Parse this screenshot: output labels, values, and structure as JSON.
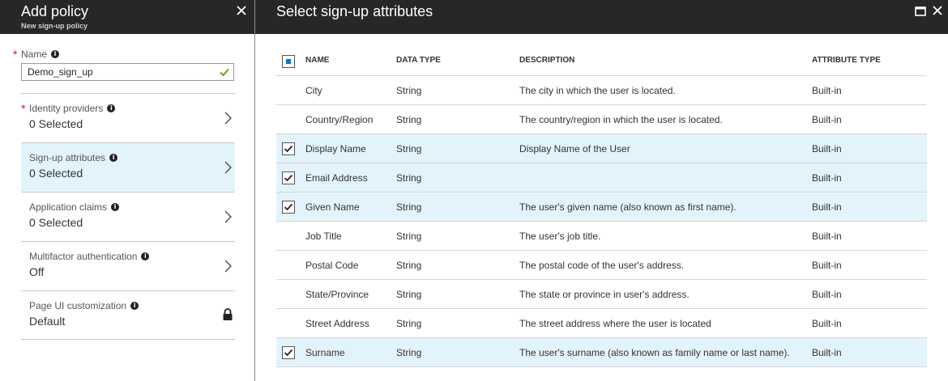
{
  "left_blade": {
    "title": "Add policy",
    "subtitle": "New sign-up policy",
    "name_field": {
      "label": "Name",
      "value": "Demo_sign_up"
    },
    "menu": [
      {
        "label": "Identity providers",
        "value": "0 Selected",
        "required": true,
        "selected": false
      },
      {
        "label": "Sign-up attributes",
        "value": "0 Selected",
        "required": false,
        "selected": true
      },
      {
        "label": "Application claims",
        "value": "0 Selected",
        "required": false,
        "selected": false
      },
      {
        "label": "Multifactor authentication",
        "value": "Off",
        "required": false,
        "selected": false
      },
      {
        "label": "Page UI customization",
        "value": "Default",
        "required": false,
        "selected": false,
        "locked": true
      }
    ]
  },
  "right_blade": {
    "title": "Select sign-up attributes",
    "columns": {
      "name": "NAME",
      "data_type": "DATA TYPE",
      "description": "DESCRIPTION",
      "attribute_type": "ATTRIBUTE TYPE"
    },
    "rows": [
      {
        "name": "City",
        "type": "String",
        "desc": "The city in which the user is located.",
        "attr": "Built-in",
        "checked": false
      },
      {
        "name": "Country/Region",
        "type": "String",
        "desc": "The country/region in which the user is located.",
        "attr": "Built-in",
        "checked": false
      },
      {
        "name": "Display Name",
        "type": "String",
        "desc": "Display Name of the User",
        "attr": "Built-in",
        "checked": true
      },
      {
        "name": "Email Address",
        "type": "String",
        "desc": "",
        "attr": "Built-in",
        "checked": true
      },
      {
        "name": "Given Name",
        "type": "String",
        "desc": "The user's given name (also known as first name).",
        "attr": "Built-in",
        "checked": true
      },
      {
        "name": "Job Title",
        "type": "String",
        "desc": "The user's job title.",
        "attr": "Built-in",
        "checked": false
      },
      {
        "name": "Postal Code",
        "type": "String",
        "desc": "The postal code of the user's address.",
        "attr": "Built-in",
        "checked": false
      },
      {
        "name": "State/Province",
        "type": "String",
        "desc": "The state or province in user's address.",
        "attr": "Built-in",
        "checked": false
      },
      {
        "name": "Street Address",
        "type": "String",
        "desc": "The street address where the user is located",
        "attr": "Built-in",
        "checked": false
      },
      {
        "name": "Surname",
        "type": "String",
        "desc": "The user's surname (also known as family name or last name).",
        "attr": "Built-in",
        "checked": true
      }
    ]
  },
  "colors": {
    "header_bg": "#272727",
    "selected_bg": "#e3f3fb",
    "accent": "#0078d7",
    "required": "#e00b1c",
    "valid_check": "#57a300"
  },
  "icons": {
    "close": "close-icon",
    "maximize": "maximize-icon",
    "chevron": "chevron-right-icon",
    "info": "info-icon",
    "lock": "lock-icon",
    "check": "checkmark-icon"
  }
}
